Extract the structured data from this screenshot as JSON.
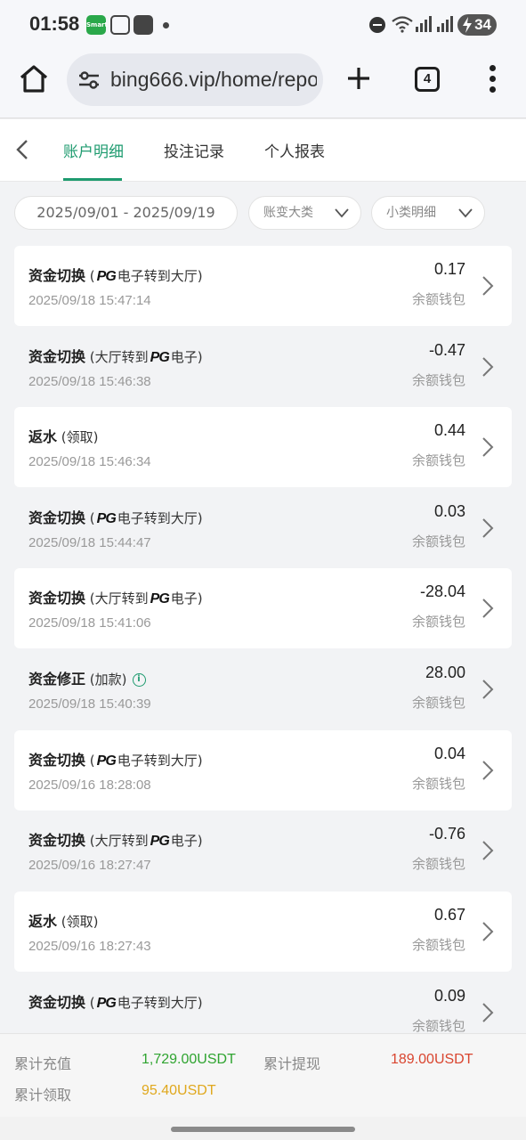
{
  "status_bar": {
    "time": "01:58",
    "battery": "34",
    "app_icons": [
      "smart-app-icon",
      "scan-icon",
      "shopping-bag-icon"
    ]
  },
  "browser": {
    "url": "bing666.vip/home/repo",
    "tab_count": "4"
  },
  "header": {
    "tabs": [
      {
        "label": "账户明细",
        "active": true
      },
      {
        "label": "投注记录",
        "active": false
      },
      {
        "label": "个人报表",
        "active": false
      }
    ]
  },
  "filters": {
    "date_range": "2025/09/01 - 2025/09/19",
    "category": "账变大类",
    "subcategory": "小类明细"
  },
  "records": [
    {
      "title": "资金切换",
      "note_pre": "(",
      "pg": "PG",
      "note_post": "电子转到大厅)",
      "datetime": "2025/09/18 15:47:14",
      "amount": "0.17",
      "wallet": "余额钱包"
    },
    {
      "title": "资金切换",
      "note_pre": "(大厅转到",
      "pg": "PG",
      "note_post": "电子)",
      "datetime": "2025/09/18 15:46:38",
      "amount": "-0.47",
      "wallet": "余额钱包"
    },
    {
      "title": "返水",
      "note_pre": "(领取)",
      "pg": "",
      "note_post": "",
      "datetime": "2025/09/18 15:46:34",
      "amount": "0.44",
      "wallet": "余额钱包"
    },
    {
      "title": "资金切换",
      "note_pre": "(",
      "pg": "PG",
      "note_post": "电子转到大厅)",
      "datetime": "2025/09/18 15:44:47",
      "amount": "0.03",
      "wallet": "余额钱包"
    },
    {
      "title": "资金切换",
      "note_pre": "(大厅转到",
      "pg": "PG",
      "note_post": "电子)",
      "datetime": "2025/09/18 15:41:06",
      "amount": "-28.04",
      "wallet": "余额钱包"
    },
    {
      "title": "资金修正",
      "note_pre": "(加款)",
      "pg": "",
      "note_post": "",
      "info": "i",
      "datetime": "2025/09/18 15:40:39",
      "amount": "28.00",
      "wallet": "余额钱包"
    },
    {
      "title": "资金切换",
      "note_pre": "(",
      "pg": "PG",
      "note_post": "电子转到大厅)",
      "datetime": "2025/09/16 18:28:08",
      "amount": "0.04",
      "wallet": "余额钱包"
    },
    {
      "title": "资金切换",
      "note_pre": "(大厅转到",
      "pg": "PG",
      "note_post": "电子)",
      "datetime": "2025/09/16 18:27:47",
      "amount": "-0.76",
      "wallet": "余额钱包"
    },
    {
      "title": "返水",
      "note_pre": "(领取)",
      "pg": "",
      "note_post": "",
      "datetime": "2025/09/16 18:27:43",
      "amount": "0.67",
      "wallet": "余额钱包"
    },
    {
      "title": "资金切换",
      "note_pre": "(",
      "pg": "PG",
      "note_post": "电子转到大厅)",
      "datetime": "",
      "amount": "0.09",
      "wallet": "余额钱包"
    }
  ],
  "summary": {
    "deposit_label": "累计充值",
    "deposit_value": "1,729.00USDT",
    "withdraw_label": "累计提现",
    "withdraw_value": "189.00USDT",
    "claim_label": "累计领取",
    "claim_value": "95.40USDT"
  },
  "colors": {
    "accent": "#1e9b6f",
    "deposit": "#2fa430",
    "withdraw": "#d9452f",
    "claim": "#e0a81d"
  }
}
